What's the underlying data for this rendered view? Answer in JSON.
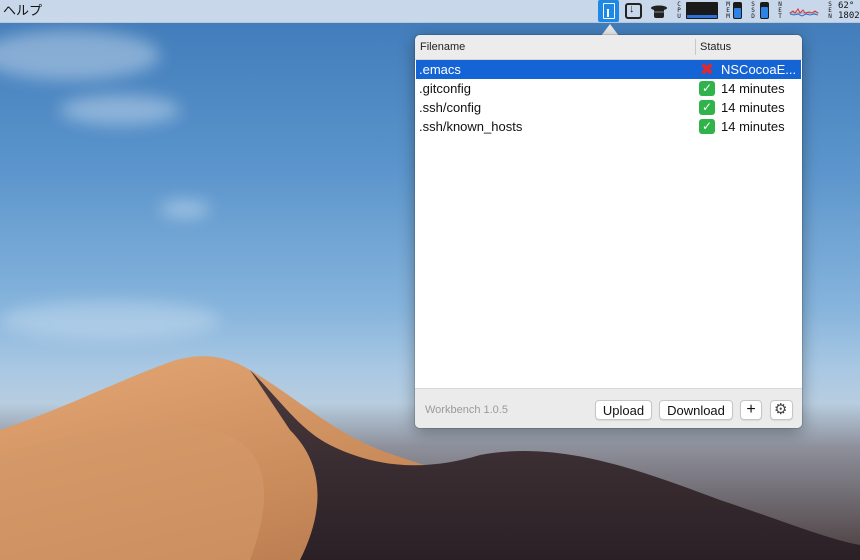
{
  "menubar": {
    "help_label": "ヘルプ",
    "tray": {
      "workbench_icon": "workbench-icon",
      "download_icon": "download-icon",
      "hat_icon": "hat-icon",
      "cpu_label": "CPU",
      "mem_label": "MEM",
      "ssd_label": "SSD",
      "net_label": "NET",
      "sen_label": "SEN",
      "temp": "62°",
      "rpm": "1802"
    }
  },
  "table": {
    "headers": {
      "filename": "Filename",
      "status": "Status"
    },
    "rows": [
      {
        "filename": ".emacs",
        "status": "NSCocoaE...",
        "state": "error",
        "icon": "red-x-icon",
        "selected": true
      },
      {
        "filename": ".gitconfig",
        "status": "14 minutes",
        "state": "ok",
        "icon": "green-check-icon",
        "selected": false
      },
      {
        "filename": ".ssh/config",
        "status": "14 minutes",
        "state": "ok",
        "icon": "green-check-icon",
        "selected": false
      },
      {
        "filename": ".ssh/known_hosts",
        "status": "14 minutes",
        "state": "ok",
        "icon": "green-check-icon",
        "selected": false
      }
    ]
  },
  "footer": {
    "version": "Workbench 1.0.5",
    "upload_label": "Upload",
    "download_label": "Download",
    "add_label": "+",
    "settings_icon": "gear-icon"
  },
  "colors": {
    "selection": "#1564d6",
    "ok": "#2fb34a",
    "error": "#e0282e",
    "accent": "#1e88e5"
  }
}
